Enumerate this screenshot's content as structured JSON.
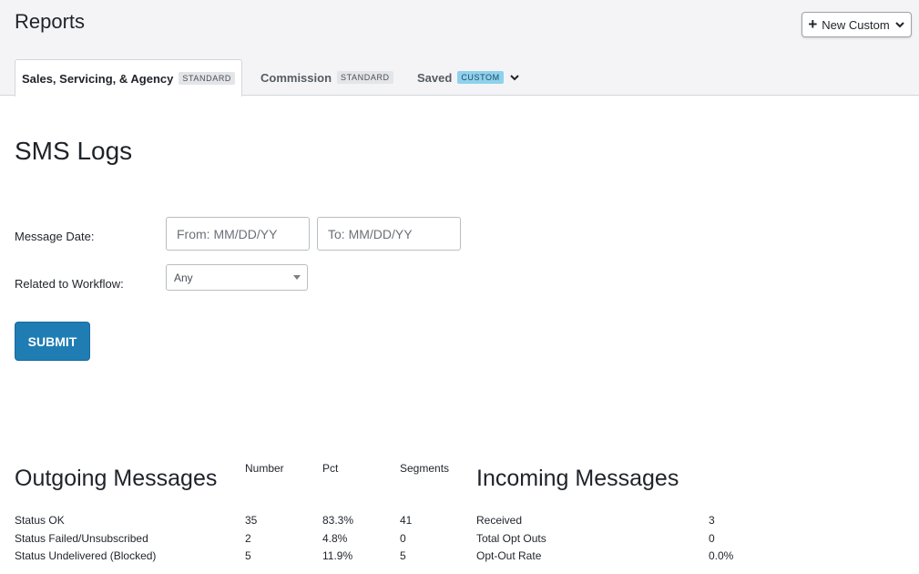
{
  "header": {
    "title": "Reports",
    "new_custom_label": "New Custom",
    "tabs": [
      {
        "label": "Sales, Servicing, & Agency",
        "badge": "STANDARD",
        "active": true
      },
      {
        "label": "Commission",
        "badge": "STANDARD",
        "active": false
      },
      {
        "label": "Saved",
        "badge": "CUSTOM",
        "active": false
      }
    ]
  },
  "report": {
    "title": "SMS Logs",
    "message_date_label": "Message Date:",
    "from_placeholder": "From: MM/DD/YY",
    "to_placeholder": "To: MM/DD/YY",
    "workflow_label": "Related to Workflow:",
    "workflow_selected": "Any",
    "submit_label": "SUBMIT"
  },
  "outgoing": {
    "title": "Outgoing Messages",
    "columns": [
      "Number",
      "Pct",
      "Segments"
    ],
    "rows": [
      {
        "label": "Status OK",
        "number": "35",
        "pct": "83.3%",
        "segments": "41"
      },
      {
        "label": "Status Failed/Unsubscribed",
        "number": "2",
        "pct": "4.8%",
        "segments": "0"
      },
      {
        "label": "Status Undelivered (Blocked)",
        "number": "5",
        "pct": "11.9%",
        "segments": "5"
      }
    ]
  },
  "incoming": {
    "title": "Incoming Messages",
    "rows": [
      {
        "label": "Received",
        "value": "3"
      },
      {
        "label": "Total Opt Outs",
        "value": "0"
      },
      {
        "label": "Opt-Out Rate",
        "value": "0.0%"
      }
    ]
  },
  "colors": {
    "header_bg": "#f4f4f6",
    "submit_bg": "#1f7db4",
    "custom_badge": "#8fd1ec",
    "standard_badge": "#e3e5e8"
  }
}
